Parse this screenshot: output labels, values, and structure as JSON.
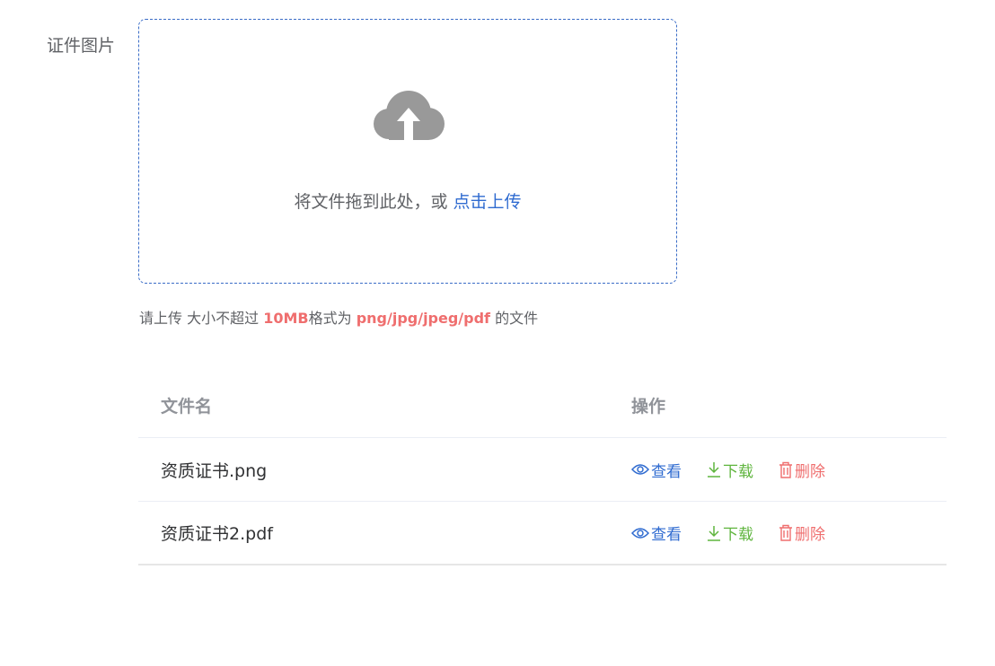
{
  "form": {
    "label": "证件图片"
  },
  "upload": {
    "drag_text": "将文件拖到此处，或",
    "click_text": "点击上传",
    "icon": "cloud-upload-icon",
    "tip": {
      "p1": "请上传 大小不超过",
      "size": "10MB",
      "p2": "格式为",
      "formats": "png/jpg/jpeg/pdf",
      "p3": "的文件"
    }
  },
  "table": {
    "headers": {
      "name": "文件名",
      "ops": "操作"
    },
    "rows": [
      {
        "name": "资质证书.png",
        "view": "查看",
        "download": "下载",
        "delete": "删除"
      },
      {
        "name": "资质证书2.pdf",
        "view": "查看",
        "download": "下载",
        "delete": "删除"
      }
    ]
  },
  "colors": {
    "primary": "#2f6bd0",
    "success": "#5fb53e",
    "danger": "#ef6e6e",
    "text": "#606266"
  }
}
